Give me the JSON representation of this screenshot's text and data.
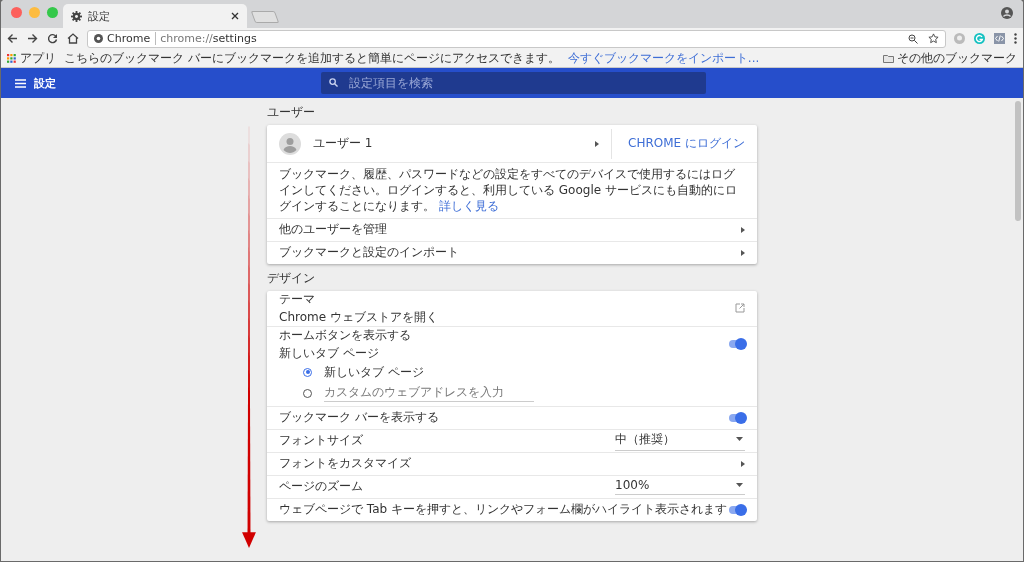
{
  "window": {
    "tab": {
      "title": "設定"
    }
  },
  "toolbar": {
    "origin": "Chrome",
    "url_scheme": "chrome://",
    "url_path": "settings"
  },
  "bookmarks_bar": {
    "apps": "アプリ",
    "message": "こちらのブックマーク バーにブックマークを追加すると簡単にページにアクセスできます。",
    "import_link": "今すぐブックマークをインポート...",
    "other": "その他のブックマーク"
  },
  "header": {
    "title": "設定",
    "search": {
      "placeholder": "設定項目を検索"
    }
  },
  "sections": [
    {
      "title": "ユーザー",
      "rows": [
        {
          "kind": "profile",
          "label": "ユーザー 1",
          "action": "CHROME にログイン"
        },
        {
          "kind": "text",
          "text": "ブックマーク、履歴、パスワードなどの設定をすべてのデバイスで使用するにはログインしてください。ログインすると、利用している Google サービスにも自動的にログインすることになります。",
          "link": "詳しく見る"
        },
        {
          "kind": "link",
          "label": "他のユーザーを管理"
        },
        {
          "kind": "link",
          "label": "ブックマークと設定のインポート"
        }
      ]
    },
    {
      "title": "デザイン",
      "rows": [
        {
          "kind": "external",
          "label": "テーマ",
          "sublabel": "Chrome ウェブストアを開く"
        },
        {
          "kind": "toggle",
          "label": "ホームボタンを表示する",
          "sublabel": "新しいタブ ページ",
          "on": true,
          "options": [
            {
              "label": "新しいタブ ページ",
              "selected": true
            },
            {
              "placeholder": "カスタムのウェブアドレスを入力",
              "selected": false
            }
          ]
        },
        {
          "kind": "toggle",
          "label": "ブックマーク バーを表示する",
          "on": true
        },
        {
          "kind": "select",
          "label": "フォントサイズ",
          "value": "中（推奨）"
        },
        {
          "kind": "link",
          "label": "フォントをカスタマイズ"
        },
        {
          "kind": "select",
          "label": "ページのズーム",
          "value": "100%"
        },
        {
          "kind": "toggle",
          "label": "ウェブページで Tab キーを押すと、リンクやフォーム欄がハイライト表示されます",
          "on": true
        }
      ]
    }
  ]
}
